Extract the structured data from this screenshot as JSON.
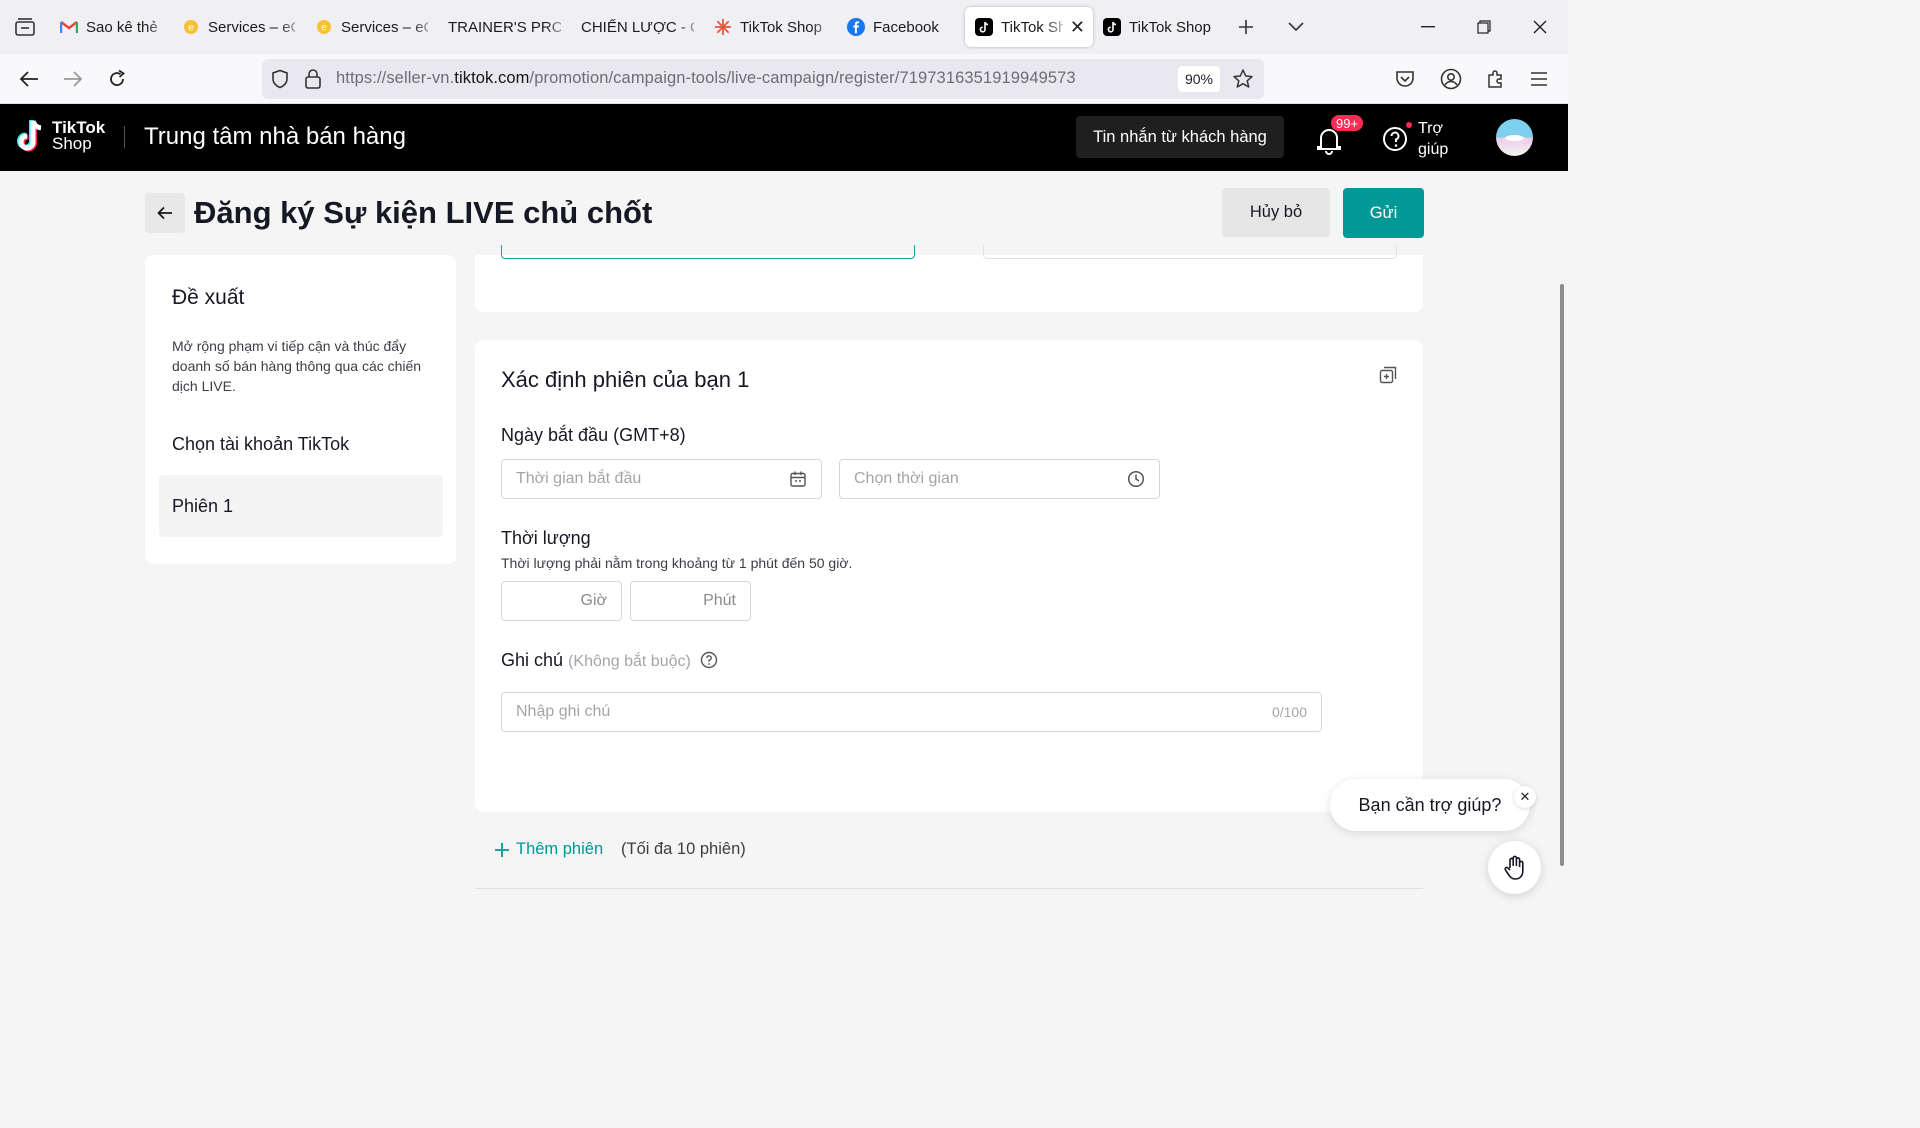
{
  "browser": {
    "tabs": [
      {
        "title": "Sao kê thẻ tí",
        "icon": "gmail-icon"
      },
      {
        "title": "Services – eC",
        "icon": "ecom-icon"
      },
      {
        "title": "Services – eC",
        "icon": "ecom-icon"
      },
      {
        "title": "TRAINER'S PROF",
        "icon": ""
      },
      {
        "title": "CHIẾN LƯỢC - C",
        "icon": ""
      },
      {
        "title": "TikTok Shop",
        "icon": "sun-icon"
      },
      {
        "title": "Facebook",
        "icon": "facebook-icon"
      },
      {
        "title": "TikTok Sh",
        "icon": "tiktok-icon",
        "active": true
      },
      {
        "title": "TikTok Shop",
        "icon": "tiktok-icon"
      }
    ],
    "url_prefix": "https://seller-vn.",
    "url_domain": "tiktok.com",
    "url_path": "/promotion/campaign-tools/live-campaign/register/7197316351919949573",
    "zoom": "90%"
  },
  "header": {
    "brand_top": "TikTok",
    "brand_bottom": "Shop",
    "center_title": "Trung tâm nhà bán hàng",
    "messages_label": "Tin nhắn từ khách hàng",
    "notif_badge": "99+",
    "help_line1": "Trợ",
    "help_line2": "giúp"
  },
  "page": {
    "title": "Đăng ký Sự kiện LIVE chủ chốt",
    "cancel_label": "Hủy bỏ",
    "submit_label": "Gửi"
  },
  "sidebar": {
    "title": "Đề xuất",
    "description": "Mở rộng phạm vi tiếp cận và thúc đẩy doanh số bán hàng thông qua các chiến dịch LIVE.",
    "items": [
      {
        "label": "Chọn tài khoản TikTok"
      },
      {
        "label": "Phiên 1"
      }
    ]
  },
  "session": {
    "title": "Xác định phiên của bạn 1",
    "start_label": "Ngày bắt đầu (GMT+8)",
    "start_date_placeholder": "Thời gian bắt đầu",
    "start_time_placeholder": "Chọn thời gian",
    "duration_label": "Thời lượng",
    "duration_hint": "Thời lượng phải nằm trong khoảng từ 1 phút đến 50 giờ.",
    "hours_placeholder": "Giờ",
    "minutes_placeholder": "Phút",
    "note_label": "Ghi chú",
    "note_optional": "(Không bắt buộc)",
    "note_placeholder": "Nhập ghi chú",
    "note_counter": "0/100"
  },
  "footer": {
    "add_session": "Thêm phiên",
    "add_limit": "(Tối đa 10 phiên)"
  },
  "help_widget": {
    "bubble_text": "Bạn cần trợ giúp?"
  },
  "colors": {
    "accent": "#009995",
    "header_bg": "#000000",
    "badge": "#fe2c55"
  }
}
